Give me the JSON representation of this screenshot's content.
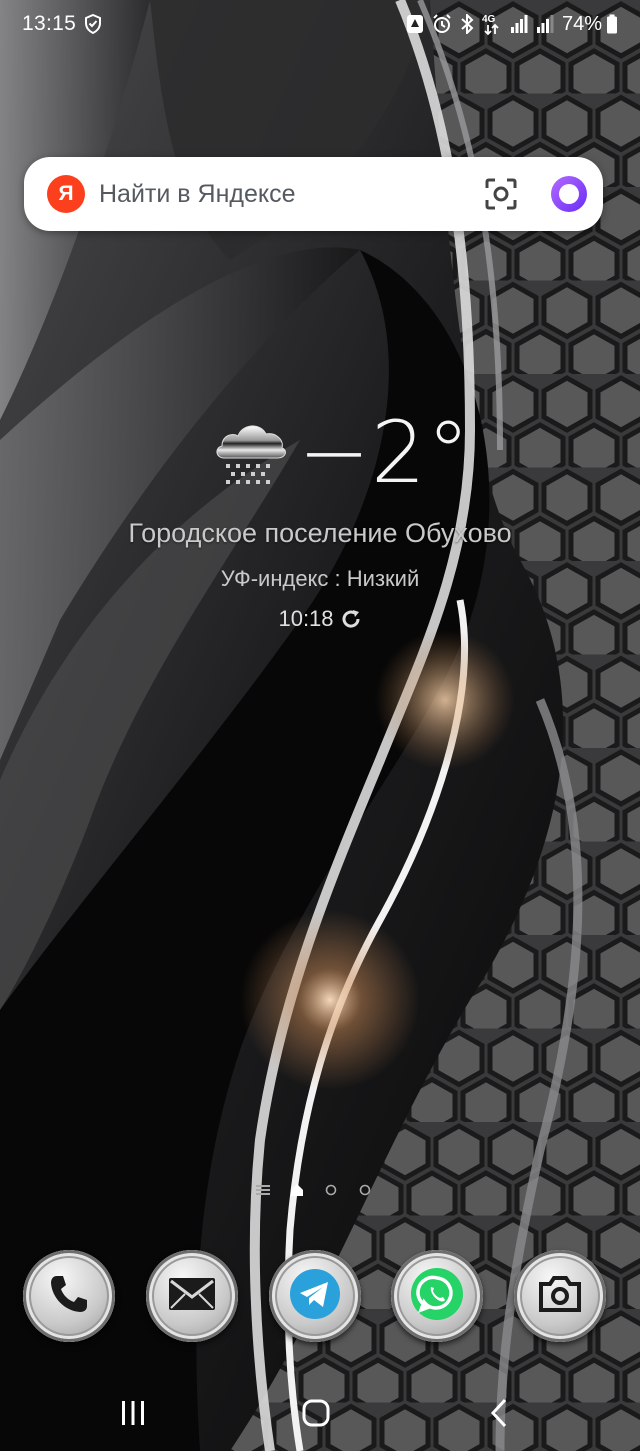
{
  "status_bar": {
    "time": "13:15",
    "network_label": "4G",
    "battery": "74%",
    "icons": [
      "shield-check-icon",
      "app-notification-icon",
      "alarm-icon",
      "bluetooth-icon",
      "mobile-data-icon",
      "signal-sim1-icon",
      "signal-sim2-icon",
      "battery-icon"
    ]
  },
  "search": {
    "logo_letter": "Я",
    "placeholder": "Найти в Яндексе",
    "icons": [
      "yandex-logo-icon",
      "camera-lens-icon",
      "alice-voice-icon"
    ]
  },
  "weather": {
    "temperature": "−2°",
    "location": "Городское поселение Обухово",
    "uv_index": "УФ-индекс : Низкий",
    "updated_time": "10:18",
    "icon": "snow-cloud-icon"
  },
  "page_indicator": {
    "pages": [
      "menu-lines",
      "home",
      "dot",
      "dot"
    ],
    "active_index": 1
  },
  "dock": {
    "apps": [
      {
        "name": "Phone",
        "icon": "phone-icon"
      },
      {
        "name": "Messages",
        "icon": "envelope-icon"
      },
      {
        "name": "Telegram",
        "icon": "telegram-icon",
        "color": "#2aa1da"
      },
      {
        "name": "WhatsApp",
        "icon": "whatsapp-icon",
        "color": "#25d366"
      },
      {
        "name": "Camera",
        "icon": "camera-icon"
      }
    ]
  },
  "nav": {
    "buttons": [
      "recents-button",
      "home-button",
      "back-button"
    ]
  },
  "colors": {
    "yandex_red": "#fc3f1d",
    "alice_purple": "#8b3ffd",
    "telegram_blue": "#2aa1da",
    "whatsapp_green": "#25d366"
  }
}
